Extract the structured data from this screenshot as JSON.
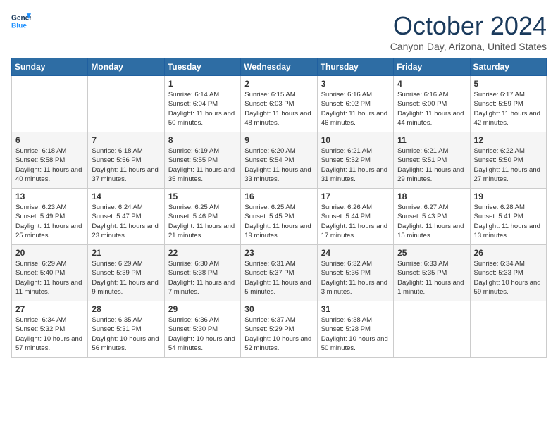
{
  "header": {
    "logo_line1": "General",
    "logo_line2": "Blue",
    "month_title": "October 2024",
    "location": "Canyon Day, Arizona, United States"
  },
  "weekdays": [
    "Sunday",
    "Monday",
    "Tuesday",
    "Wednesday",
    "Thursday",
    "Friday",
    "Saturday"
  ],
  "weeks": [
    [
      {
        "day": "",
        "sunrise": "",
        "sunset": "",
        "daylight": ""
      },
      {
        "day": "",
        "sunrise": "",
        "sunset": "",
        "daylight": ""
      },
      {
        "day": "1",
        "sunrise": "Sunrise: 6:14 AM",
        "sunset": "Sunset: 6:04 PM",
        "daylight": "Daylight: 11 hours and 50 minutes."
      },
      {
        "day": "2",
        "sunrise": "Sunrise: 6:15 AM",
        "sunset": "Sunset: 6:03 PM",
        "daylight": "Daylight: 11 hours and 48 minutes."
      },
      {
        "day": "3",
        "sunrise": "Sunrise: 6:16 AM",
        "sunset": "Sunset: 6:02 PM",
        "daylight": "Daylight: 11 hours and 46 minutes."
      },
      {
        "day": "4",
        "sunrise": "Sunrise: 6:16 AM",
        "sunset": "Sunset: 6:00 PM",
        "daylight": "Daylight: 11 hours and 44 minutes."
      },
      {
        "day": "5",
        "sunrise": "Sunrise: 6:17 AM",
        "sunset": "Sunset: 5:59 PM",
        "daylight": "Daylight: 11 hours and 42 minutes."
      }
    ],
    [
      {
        "day": "6",
        "sunrise": "Sunrise: 6:18 AM",
        "sunset": "Sunset: 5:58 PM",
        "daylight": "Daylight: 11 hours and 40 minutes."
      },
      {
        "day": "7",
        "sunrise": "Sunrise: 6:18 AM",
        "sunset": "Sunset: 5:56 PM",
        "daylight": "Daylight: 11 hours and 37 minutes."
      },
      {
        "day": "8",
        "sunrise": "Sunrise: 6:19 AM",
        "sunset": "Sunset: 5:55 PM",
        "daylight": "Daylight: 11 hours and 35 minutes."
      },
      {
        "day": "9",
        "sunrise": "Sunrise: 6:20 AM",
        "sunset": "Sunset: 5:54 PM",
        "daylight": "Daylight: 11 hours and 33 minutes."
      },
      {
        "day": "10",
        "sunrise": "Sunrise: 6:21 AM",
        "sunset": "Sunset: 5:52 PM",
        "daylight": "Daylight: 11 hours and 31 minutes."
      },
      {
        "day": "11",
        "sunrise": "Sunrise: 6:21 AM",
        "sunset": "Sunset: 5:51 PM",
        "daylight": "Daylight: 11 hours and 29 minutes."
      },
      {
        "day": "12",
        "sunrise": "Sunrise: 6:22 AM",
        "sunset": "Sunset: 5:50 PM",
        "daylight": "Daylight: 11 hours and 27 minutes."
      }
    ],
    [
      {
        "day": "13",
        "sunrise": "Sunrise: 6:23 AM",
        "sunset": "Sunset: 5:49 PM",
        "daylight": "Daylight: 11 hours and 25 minutes."
      },
      {
        "day": "14",
        "sunrise": "Sunrise: 6:24 AM",
        "sunset": "Sunset: 5:47 PM",
        "daylight": "Daylight: 11 hours and 23 minutes."
      },
      {
        "day": "15",
        "sunrise": "Sunrise: 6:25 AM",
        "sunset": "Sunset: 5:46 PM",
        "daylight": "Daylight: 11 hours and 21 minutes."
      },
      {
        "day": "16",
        "sunrise": "Sunrise: 6:25 AM",
        "sunset": "Sunset: 5:45 PM",
        "daylight": "Daylight: 11 hours and 19 minutes."
      },
      {
        "day": "17",
        "sunrise": "Sunrise: 6:26 AM",
        "sunset": "Sunset: 5:44 PM",
        "daylight": "Daylight: 11 hours and 17 minutes."
      },
      {
        "day": "18",
        "sunrise": "Sunrise: 6:27 AM",
        "sunset": "Sunset: 5:43 PM",
        "daylight": "Daylight: 11 hours and 15 minutes."
      },
      {
        "day": "19",
        "sunrise": "Sunrise: 6:28 AM",
        "sunset": "Sunset: 5:41 PM",
        "daylight": "Daylight: 11 hours and 13 minutes."
      }
    ],
    [
      {
        "day": "20",
        "sunrise": "Sunrise: 6:29 AM",
        "sunset": "Sunset: 5:40 PM",
        "daylight": "Daylight: 11 hours and 11 minutes."
      },
      {
        "day": "21",
        "sunrise": "Sunrise: 6:29 AM",
        "sunset": "Sunset: 5:39 PM",
        "daylight": "Daylight: 11 hours and 9 minutes."
      },
      {
        "day": "22",
        "sunrise": "Sunrise: 6:30 AM",
        "sunset": "Sunset: 5:38 PM",
        "daylight": "Daylight: 11 hours and 7 minutes."
      },
      {
        "day": "23",
        "sunrise": "Sunrise: 6:31 AM",
        "sunset": "Sunset: 5:37 PM",
        "daylight": "Daylight: 11 hours and 5 minutes."
      },
      {
        "day": "24",
        "sunrise": "Sunrise: 6:32 AM",
        "sunset": "Sunset: 5:36 PM",
        "daylight": "Daylight: 11 hours and 3 minutes."
      },
      {
        "day": "25",
        "sunrise": "Sunrise: 6:33 AM",
        "sunset": "Sunset: 5:35 PM",
        "daylight": "Daylight: 11 hours and 1 minute."
      },
      {
        "day": "26",
        "sunrise": "Sunrise: 6:34 AM",
        "sunset": "Sunset: 5:33 PM",
        "daylight": "Daylight: 10 hours and 59 minutes."
      }
    ],
    [
      {
        "day": "27",
        "sunrise": "Sunrise: 6:34 AM",
        "sunset": "Sunset: 5:32 PM",
        "daylight": "Daylight: 10 hours and 57 minutes."
      },
      {
        "day": "28",
        "sunrise": "Sunrise: 6:35 AM",
        "sunset": "Sunset: 5:31 PM",
        "daylight": "Daylight: 10 hours and 56 minutes."
      },
      {
        "day": "29",
        "sunrise": "Sunrise: 6:36 AM",
        "sunset": "Sunset: 5:30 PM",
        "daylight": "Daylight: 10 hours and 54 minutes."
      },
      {
        "day": "30",
        "sunrise": "Sunrise: 6:37 AM",
        "sunset": "Sunset: 5:29 PM",
        "daylight": "Daylight: 10 hours and 52 minutes."
      },
      {
        "day": "31",
        "sunrise": "Sunrise: 6:38 AM",
        "sunset": "Sunset: 5:28 PM",
        "daylight": "Daylight: 10 hours and 50 minutes."
      },
      {
        "day": "",
        "sunrise": "",
        "sunset": "",
        "daylight": ""
      },
      {
        "day": "",
        "sunrise": "",
        "sunset": "",
        "daylight": ""
      }
    ]
  ]
}
